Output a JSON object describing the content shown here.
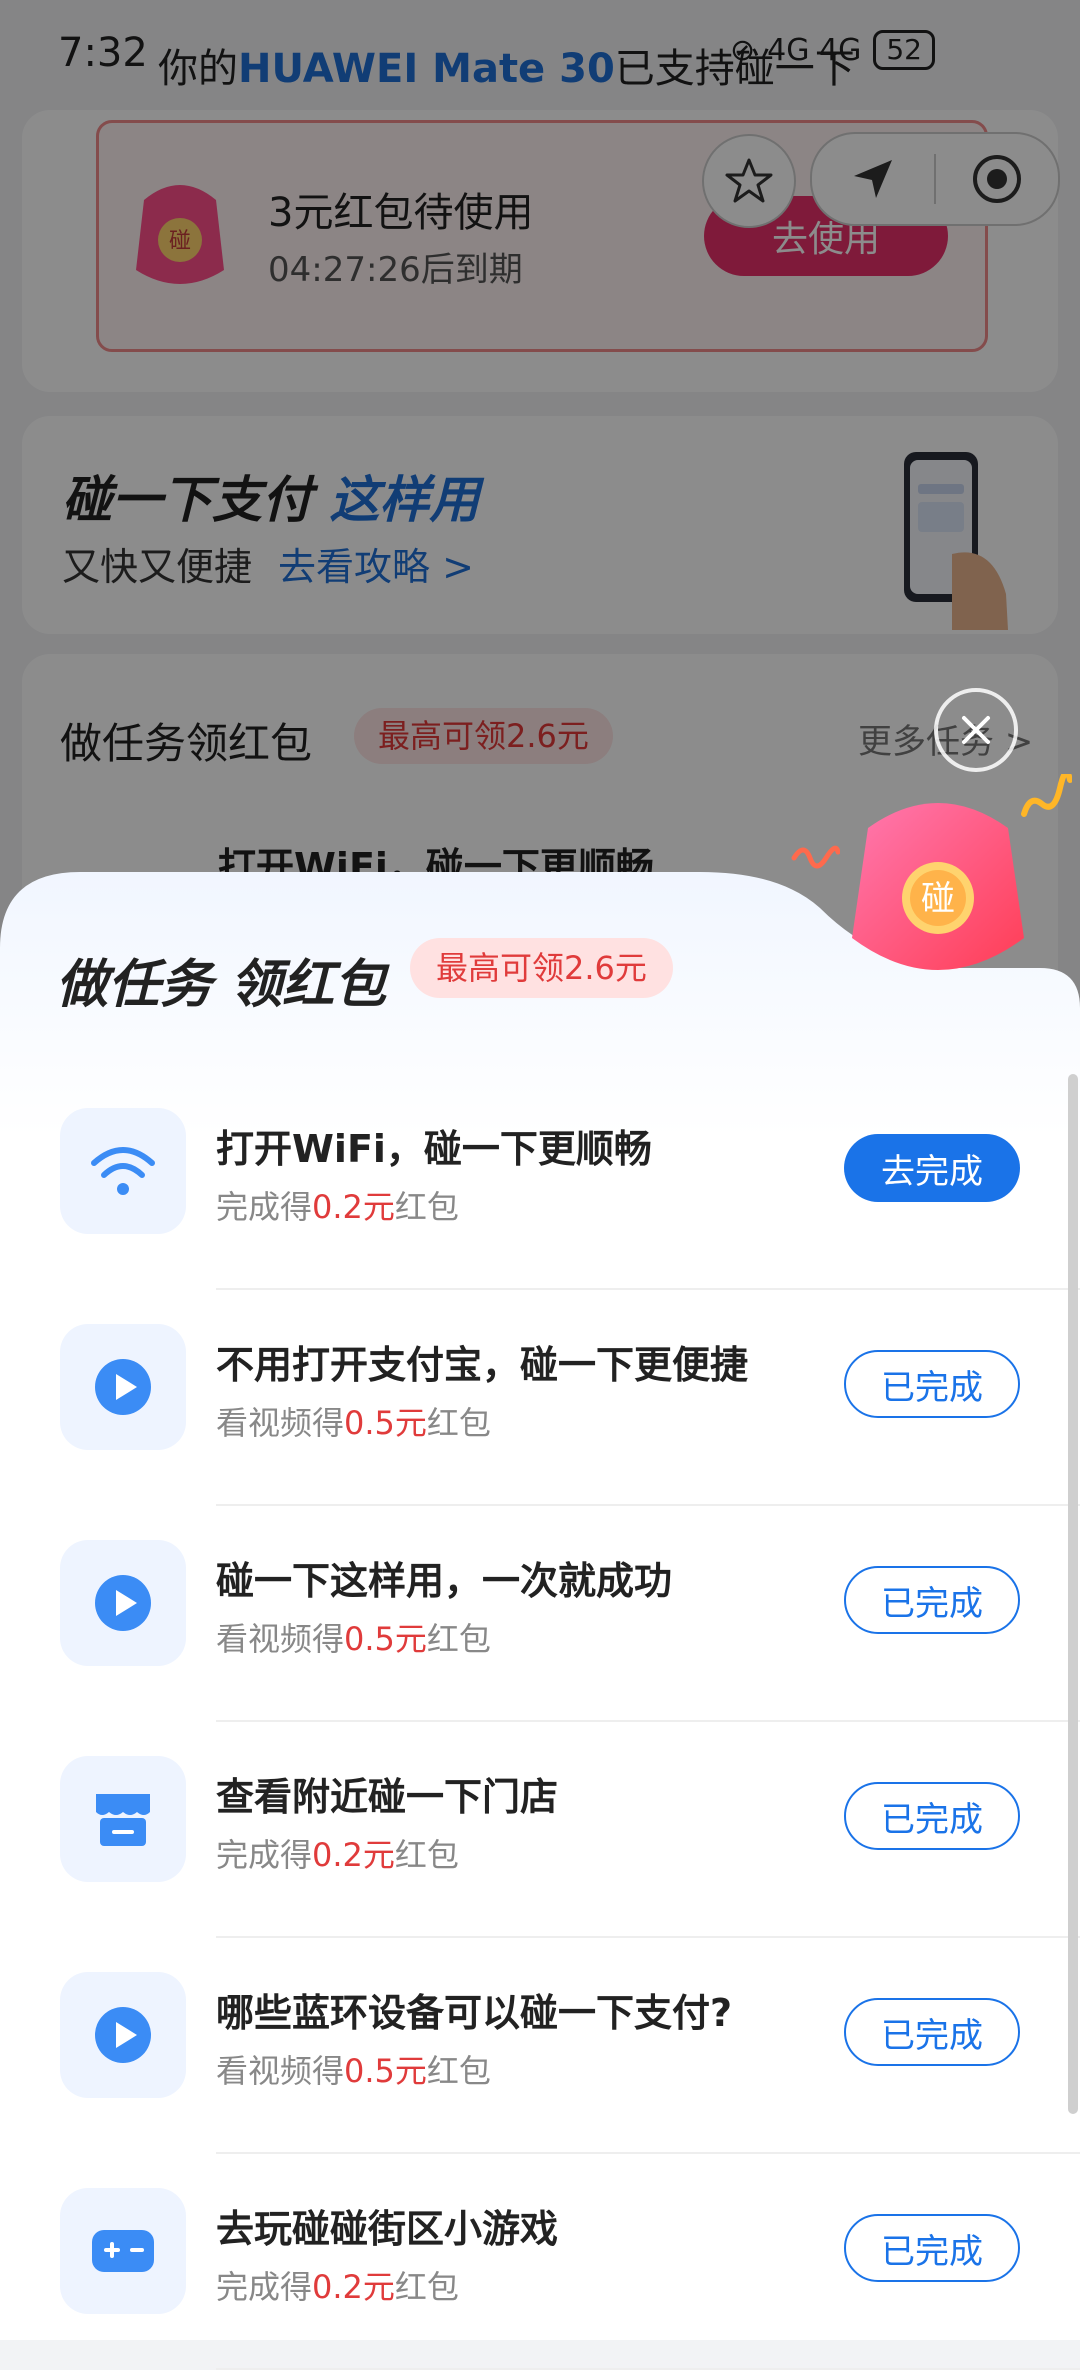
{
  "status_bar": {
    "time": "7:32",
    "notice_prefix": "你的",
    "notice_device": "HUAWEI Mate 30",
    "notice_suffix": "已支持碰一下",
    "network": "4G 4G",
    "battery": "52"
  },
  "coupon": {
    "title": "3元红包待使用",
    "expire": "04:27:26后到期",
    "button": "去使用",
    "bag_label": "碰"
  },
  "pay_intro": {
    "title_main": "碰一下支付",
    "title_highlight": "这样用",
    "subtitle": "又快又便捷",
    "link": "去看攻略 >"
  },
  "background_tasks": {
    "title": "做任务领红包",
    "badge": "最高可领2.6元",
    "more": "更多任务 >",
    "first_row": "打开WiFi，碰一下更顺畅"
  },
  "sheet": {
    "title": "做任务 领红包",
    "badge": "最高可领2.6元",
    "hero_label": "碰",
    "tasks": [
      {
        "icon": "wifi-icon",
        "title": "打开WiFi，碰一下更顺畅",
        "reward_prefix": "完成得",
        "reward_amount": "0.2元",
        "reward_suffix": "红包",
        "button": "去完成",
        "state": "todo"
      },
      {
        "icon": "play-icon",
        "title": "不用打开支付宝，碰一下更便捷",
        "reward_prefix": "看视频得",
        "reward_amount": "0.5元",
        "reward_suffix": "红包",
        "button": "已完成",
        "state": "done"
      },
      {
        "icon": "play-icon",
        "title": "碰一下这样用，一次就成功",
        "reward_prefix": "看视频得",
        "reward_amount": "0.5元",
        "reward_suffix": "红包",
        "button": "已完成",
        "state": "done"
      },
      {
        "icon": "store-icon",
        "title": "查看附近碰一下门店",
        "reward_prefix": "完成得",
        "reward_amount": "0.2元",
        "reward_suffix": "红包",
        "button": "已完成",
        "state": "done"
      },
      {
        "icon": "play-icon",
        "title": "哪些蓝环设备可以碰一下支付?",
        "reward_prefix": "看视频得",
        "reward_amount": "0.5元",
        "reward_suffix": "红包",
        "button": "已完成",
        "state": "done"
      },
      {
        "icon": "gamepad-icon",
        "title": "去玩碰碰街区小游戏",
        "reward_prefix": "完成得",
        "reward_amount": "0.2元",
        "reward_suffix": "红包",
        "button": "已完成",
        "state": "done"
      }
    ]
  },
  "colors": {
    "primary": "#1a73e8",
    "reward_red": "#e03b3b",
    "badge_bg": "#ffe1e1"
  }
}
